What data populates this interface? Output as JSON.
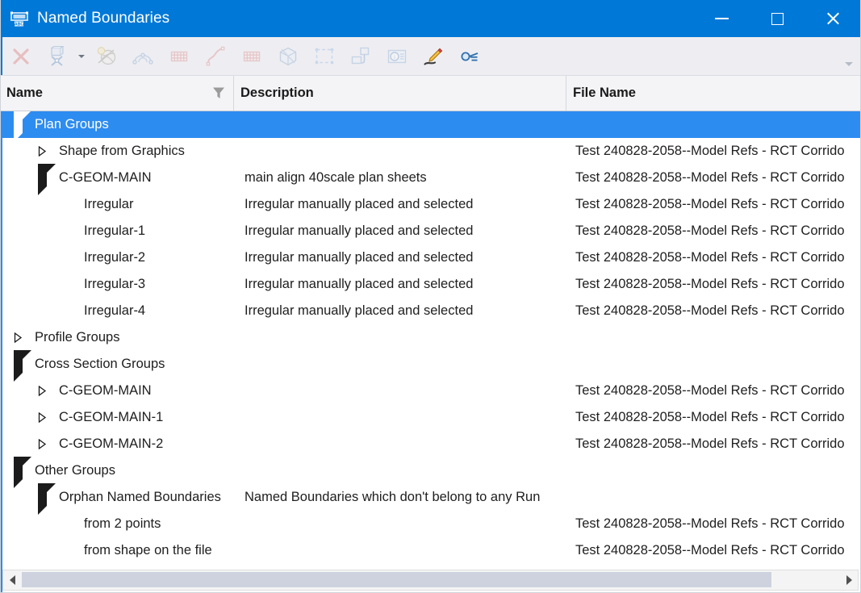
{
  "window": {
    "title": "Named Boundaries",
    "icon": "named-boundary-icon",
    "accent_color": "#0078d7",
    "selection_color": "#2d8cf0",
    "controls": {
      "minimize": "Minimize",
      "maximize": "Maximize",
      "close": "Close"
    }
  },
  "toolbar": {
    "overflow_label": "More toolbar commands",
    "items": [
      {
        "name": "delete-icon",
        "tooltip": "Delete Named Boundary",
        "enabled": false,
        "has_dropdown": false
      },
      {
        "name": "place-named-boundary-icon",
        "tooltip": "Place Named Boundary",
        "enabled": false,
        "has_dropdown": true
      },
      {
        "name": "from-drawing-boundary-icon",
        "tooltip": "From Drawing Boundary",
        "enabled": false,
        "has_dropdown": false
      },
      {
        "name": "civil-plan-icon",
        "tooltip": "Create Plan Named Boundaries",
        "enabled": false,
        "has_dropdown": false
      },
      {
        "name": "plan-grid-icon",
        "tooltip": "Plan Group Grid",
        "enabled": false,
        "has_dropdown": false
      },
      {
        "name": "profile-curve-icon",
        "tooltip": "Create Profile Named Boundaries",
        "enabled": false,
        "has_dropdown": false
      },
      {
        "name": "profile-grid-icon",
        "tooltip": "Profile Group Grid",
        "enabled": false,
        "has_dropdown": false
      },
      {
        "name": "cross-section-cube-icon",
        "tooltip": "Create Cross Section Named Boundaries",
        "enabled": false,
        "has_dropdown": false
      },
      {
        "name": "element-selection-icon",
        "tooltip": "From Element Selection",
        "enabled": false,
        "has_dropdown": false
      },
      {
        "name": "create-drawing-icon",
        "tooltip": "Create Drawing",
        "enabled": false,
        "has_dropdown": false
      },
      {
        "name": "detail-callout-icon",
        "tooltip": "Place Detail Callout",
        "enabled": false,
        "has_dropdown": false
      },
      {
        "name": "edit-pencil-icon",
        "tooltip": "Edit Named Boundary",
        "enabled": true,
        "has_dropdown": false
      },
      {
        "name": "properties-key-icon",
        "tooltip": "Properties",
        "enabled": true,
        "has_dropdown": false
      }
    ]
  },
  "grid": {
    "columns": [
      {
        "key": "name",
        "label": "Name",
        "has_filter": true,
        "filter_icon": "filter-funnel-icon"
      },
      {
        "key": "description",
        "label": "Description",
        "has_filter": false
      },
      {
        "key": "file_name",
        "label": "File Name",
        "has_filter": false
      }
    ],
    "file_name_value": "Test 240828-2058--Model Refs - RCT Corrido",
    "rows": [
      {
        "name": "Plan Groups",
        "description": "",
        "file_name": "",
        "indent": 0,
        "state": "expanded",
        "selected": true
      },
      {
        "name": "Shape from Graphics",
        "description": "",
        "file_name": "file",
        "indent": 1,
        "state": "collapsed",
        "selected": false
      },
      {
        "name": "C-GEOM-MAIN",
        "description": "main align 40scale plan sheets",
        "file_name": "file",
        "indent": 1,
        "state": "expanded",
        "selected": false
      },
      {
        "name": "Irregular",
        "description": "Irregular manually placed and selected",
        "file_name": "file",
        "indent": 2,
        "state": "leaf",
        "selected": false
      },
      {
        "name": "Irregular-1",
        "description": "Irregular manually placed and selected",
        "file_name": "file",
        "indent": 2,
        "state": "leaf",
        "selected": false
      },
      {
        "name": "Irregular-2",
        "description": "Irregular manually placed and selected",
        "file_name": "file",
        "indent": 2,
        "state": "leaf",
        "selected": false
      },
      {
        "name": "Irregular-3",
        "description": "Irregular manually placed and selected",
        "file_name": "file",
        "indent": 2,
        "state": "leaf",
        "selected": false
      },
      {
        "name": "Irregular-4",
        "description": "Irregular manually placed and selected",
        "file_name": "file",
        "indent": 2,
        "state": "leaf",
        "selected": false
      },
      {
        "name": "Profile Groups",
        "description": "",
        "file_name": "",
        "indent": 0,
        "state": "collapsed",
        "selected": false
      },
      {
        "name": "Cross Section Groups",
        "description": "",
        "file_name": "",
        "indent": 0,
        "state": "expanded",
        "selected": false
      },
      {
        "name": "C-GEOM-MAIN",
        "description": "",
        "file_name": "file",
        "indent": 1,
        "state": "collapsed",
        "selected": false
      },
      {
        "name": "C-GEOM-MAIN-1",
        "description": "",
        "file_name": "file",
        "indent": 1,
        "state": "collapsed",
        "selected": false
      },
      {
        "name": "C-GEOM-MAIN-2",
        "description": "",
        "file_name": "file",
        "indent": 1,
        "state": "collapsed",
        "selected": false
      },
      {
        "name": "Other Groups",
        "description": "",
        "file_name": "",
        "indent": 0,
        "state": "expanded",
        "selected": false
      },
      {
        "name": "Orphan Named Boundaries",
        "description": "Named Boundaries which don't belong to any Run",
        "file_name": "",
        "indent": 1,
        "state": "expanded",
        "selected": false
      },
      {
        "name": "from 2 points",
        "description": "",
        "file_name": "file",
        "indent": 2,
        "state": "leaf",
        "selected": false
      },
      {
        "name": "from shape on the file",
        "description": "",
        "file_name": "file",
        "indent": 2,
        "state": "leaf",
        "selected": false
      }
    ]
  },
  "scrollbar": {
    "left_arrow": "scroll-left-arrow",
    "right_arrow": "scroll-right-arrow",
    "thumb": "horizontal-scroll-thumb"
  }
}
